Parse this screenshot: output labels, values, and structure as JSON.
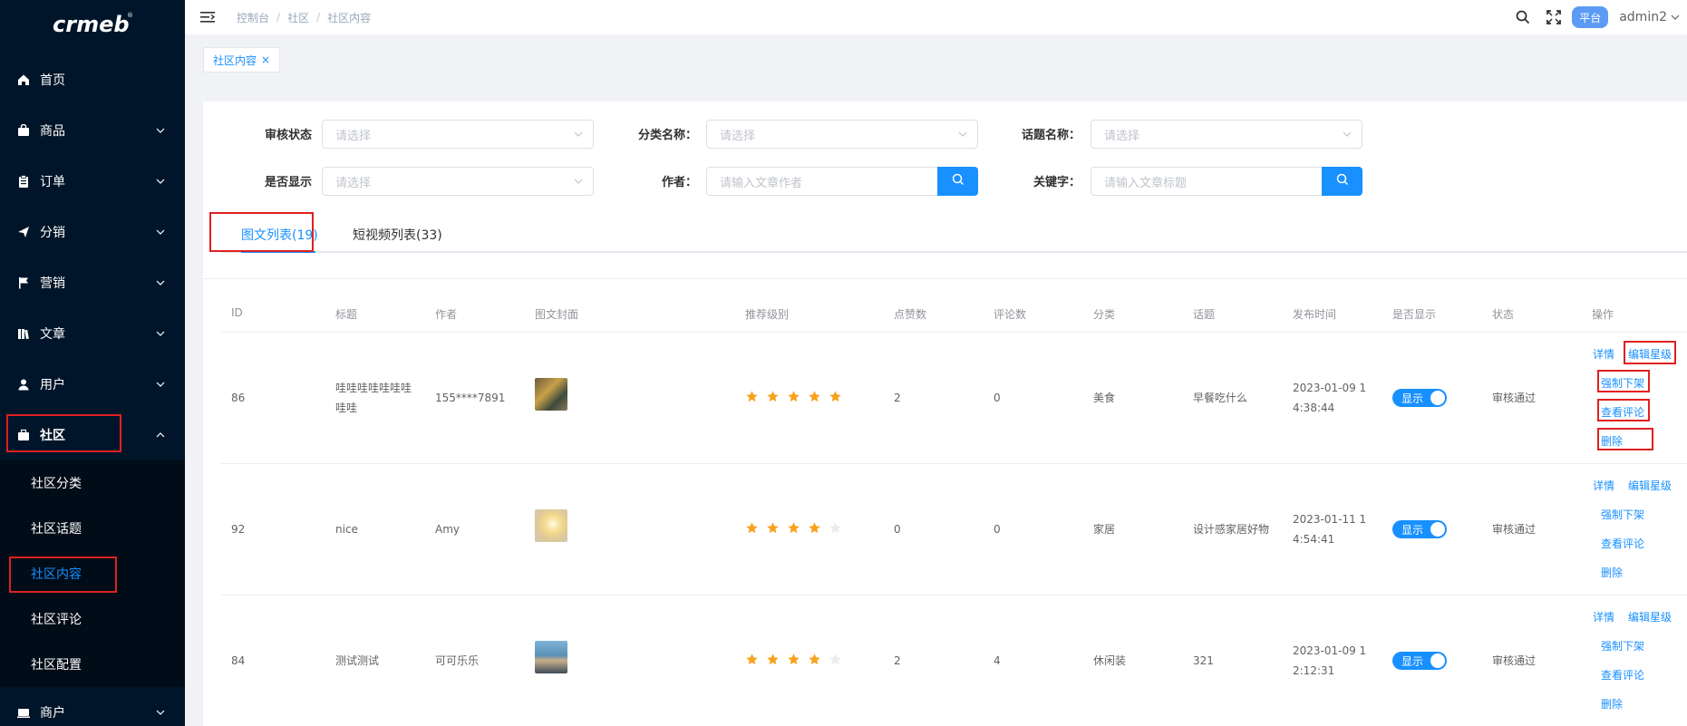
{
  "brand": {
    "logo_text": "crmeb"
  },
  "sidebar": {
    "items": [
      {
        "label": "首页",
        "icon": "home-icon"
      },
      {
        "label": "商品",
        "icon": "bag-icon"
      },
      {
        "label": "订单",
        "icon": "clipboard-icon"
      },
      {
        "label": "分销",
        "icon": "send-icon"
      },
      {
        "label": "营销",
        "icon": "flag-icon"
      },
      {
        "label": "文章",
        "icon": "book-icon"
      },
      {
        "label": "用户",
        "icon": "user-icon"
      },
      {
        "label": "社区",
        "icon": "briefcase-icon"
      }
    ],
    "sub_items": [
      "社区分类",
      "社区话题",
      "社区内容",
      "社区评论",
      "社区配置"
    ],
    "last_item": {
      "label": "商户",
      "icon": "store-icon"
    }
  },
  "header": {
    "breadcrumb": [
      "控制台",
      "社区",
      "社区内容"
    ],
    "badge": "平台",
    "user": "admin2"
  },
  "tags": [
    {
      "label": "社区内容",
      "close": "×"
    }
  ],
  "filters": {
    "review_status": {
      "label": "审核状态",
      "placeholder": "请选择"
    },
    "category": {
      "label": "分类名称：",
      "placeholder": "请选择"
    },
    "topic": {
      "label": "话题名称：",
      "placeholder": "请选择"
    },
    "show": {
      "label": "是否显示",
      "placeholder": "请选择"
    },
    "author": {
      "label": "作者：",
      "placeholder": "请输入文章作者"
    },
    "keyword": {
      "label": "关键字：",
      "placeholder": "请输入文章标题"
    }
  },
  "tabs": [
    {
      "label": "图文列表(19)",
      "active": true
    },
    {
      "label": "短视频列表(33)",
      "active": false
    }
  ],
  "table": {
    "headers": [
      "ID",
      "标题",
      "作者",
      "图文封面",
      "推荐级别",
      "点赞数",
      "评论数",
      "分类",
      "话题",
      "发布时间",
      "是否显示",
      "状态",
      "操作"
    ],
    "rows": [
      {
        "id": "86",
        "title": "哇哇哇哇哇哇哇哇哇",
        "author": "155****7891",
        "stars": 5,
        "likes": "2",
        "comments": "0",
        "category": "美食",
        "topic": "早餐吃什么",
        "time": "2023-01-09 14:38:44",
        "show": "显示",
        "status": "审核通过"
      },
      {
        "id": "92",
        "title": "nice",
        "author": "Amy",
        "stars": 4,
        "likes": "0",
        "comments": "0",
        "category": "家居",
        "topic": "设计感家居好物",
        "time": "2023-01-11 14:54:41",
        "show": "显示",
        "status": "审核通过"
      },
      {
        "id": "84",
        "title": "测试测试",
        "author": "可可乐乐",
        "stars": 4,
        "likes": "2",
        "comments": "4",
        "category": "休闲装",
        "topic": "321",
        "time": "2023-01-09 12:12:31",
        "show": "显示",
        "status": "审核通过"
      }
    ],
    "actions": [
      "详情",
      "编辑星级",
      "强制下架",
      "查看评论",
      "删除"
    ]
  },
  "colors": {
    "accent": "#1890ff",
    "sidebar": "#001529",
    "highlight": "#e02020",
    "star": "#f7a21b"
  }
}
